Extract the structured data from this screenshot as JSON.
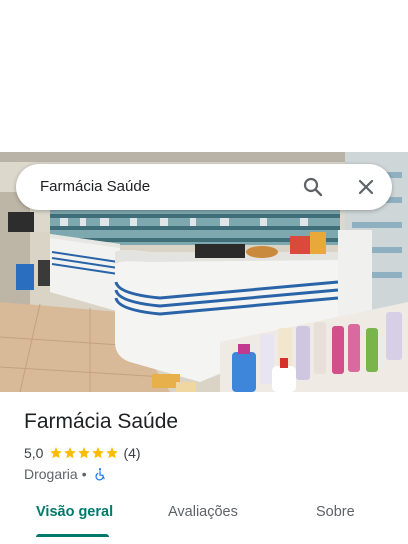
{
  "search": {
    "query": "Farmácia Saúde"
  },
  "place": {
    "title": "Farmácia Saúde",
    "rating": "5,0",
    "review_count": "(4)",
    "stars": 5,
    "category": "Drogaria",
    "separator": "•"
  },
  "tabs": [
    {
      "label": "Visão geral",
      "active": true
    },
    {
      "label": "Avaliações",
      "active": false
    },
    {
      "label": "Sobre",
      "active": false
    }
  ],
  "colors": {
    "accent": "#00796b",
    "star": "#fbbc04",
    "accessibility": "#1a73e8"
  },
  "icons": {
    "search": "search-icon",
    "close": "close-icon",
    "accessibility": "wheelchair-icon"
  }
}
